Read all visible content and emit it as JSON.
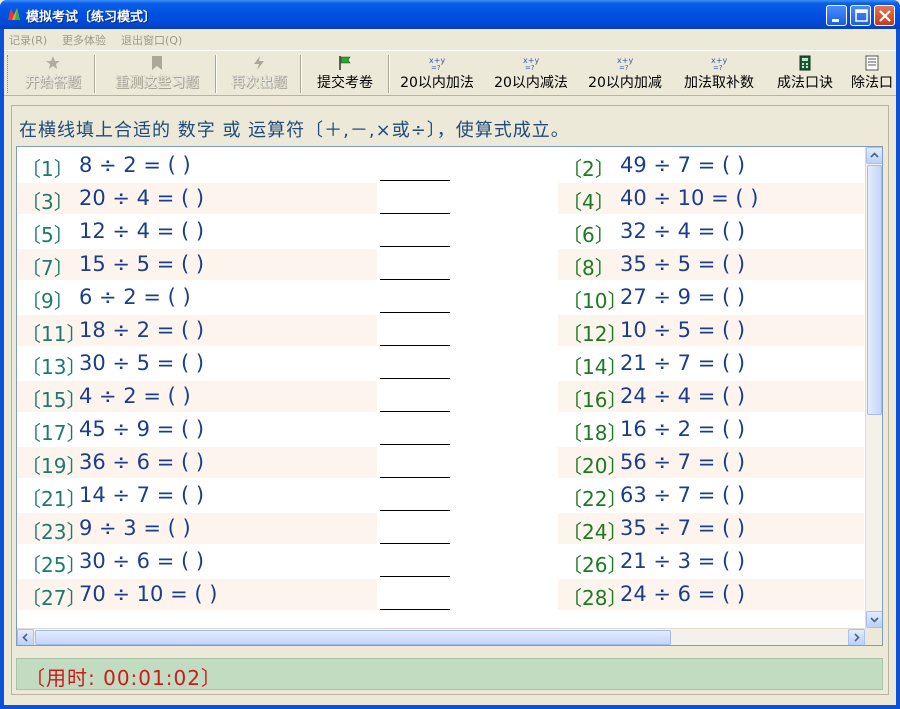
{
  "window": {
    "title": "模拟考试〔练习模式〕"
  },
  "menu": [
    "记录(R)",
    "更多体验",
    "退出窗口(Q)"
  ],
  "toolbar": [
    {
      "label": "开始答题",
      "icon": "star-pin-icon",
      "enabled": false
    },
    {
      "label": "重测这些习题",
      "icon": "bookmark-icon",
      "enabled": false
    },
    {
      "label": "再次出题",
      "icon": "lightning-icon",
      "enabled": false
    },
    {
      "label": "提交考卷",
      "icon": "flag-icon",
      "enabled": true
    },
    {
      "label": "20以内加法",
      "icon": "xy-formula-icon",
      "enabled": true
    },
    {
      "label": "20以内减法",
      "icon": "xy-formula-icon",
      "enabled": true
    },
    {
      "label": "20以内加减",
      "icon": "xy-formula-icon",
      "enabled": true
    },
    {
      "label": "加法取补数",
      "icon": "xy-formula-icon",
      "enabled": true
    },
    {
      "label": "成法口诀",
      "icon": "calculator-icon",
      "enabled": true
    },
    {
      "label": "除法口",
      "icon": "document-icon",
      "enabled": true
    }
  ],
  "instruction": "在横线填上合适的 数字 或 运算符〔＋,－,×或÷〕，使算式成立。",
  "questions": [
    {
      "num": "〔1〕",
      "expr": "8 ÷ 2 = (     )"
    },
    {
      "num": "〔2〕",
      "expr": "49 ÷ 7 = (     )"
    },
    {
      "num": "〔3〕",
      "expr": "20 ÷ 4 = (     )"
    },
    {
      "num": "〔4〕",
      "expr": "40 ÷ 10 = (     )"
    },
    {
      "num": "〔5〕",
      "expr": "12 ÷ 4 = (     )"
    },
    {
      "num": "〔6〕",
      "expr": "32 ÷ 4 = (     )"
    },
    {
      "num": "〔7〕",
      "expr": "15 ÷ 5 = (     )"
    },
    {
      "num": "〔8〕",
      "expr": "35 ÷ 5 = (     )"
    },
    {
      "num": "〔9〕",
      "expr": "6 ÷ 2 = (     )"
    },
    {
      "num": "〔10〕",
      "expr": "27 ÷ 9 = (     )"
    },
    {
      "num": "〔11〕",
      "expr": "18 ÷ 2 = (     )"
    },
    {
      "num": "〔12〕",
      "expr": "10 ÷ 5 = (     )"
    },
    {
      "num": "〔13〕",
      "expr": "30 ÷ 5 = (     )"
    },
    {
      "num": "〔14〕",
      "expr": "21 ÷ 7 = (     )"
    },
    {
      "num": "〔15〕",
      "expr": "4 ÷ 2 = (     )"
    },
    {
      "num": "〔16〕",
      "expr": "24 ÷ 4 = (     )"
    },
    {
      "num": "〔17〕",
      "expr": "45 ÷ 9 = (     )"
    },
    {
      "num": "〔18〕",
      "expr": "16 ÷ 2 = (     )"
    },
    {
      "num": "〔19〕",
      "expr": "36 ÷ 6 = (     )"
    },
    {
      "num": "〔20〕",
      "expr": "56 ÷ 7 = (     )"
    },
    {
      "num": "〔21〕",
      "expr": "14 ÷ 7 = (     )"
    },
    {
      "num": "〔22〕",
      "expr": "63 ÷ 7 = (     )"
    },
    {
      "num": "〔23〕",
      "expr": "9 ÷ 3 = (     )"
    },
    {
      "num": "〔24〕",
      "expr": "35 ÷ 7 = (     )"
    },
    {
      "num": "〔25〕",
      "expr": "30 ÷ 6 = (     )"
    },
    {
      "num": "〔26〕",
      "expr": "21 ÷ 3 = (     )"
    },
    {
      "num": "〔27〕",
      "expr": "70 ÷ 10 = (     )"
    },
    {
      "num": "〔28〕",
      "expr": "24 ÷ 6 = (     )"
    }
  ],
  "timer": "〔用时: 00:01:02〕",
  "colors": {
    "question_number_left": "#1f7a6e",
    "question_number_right": "#1c7a22",
    "expression": "#1a3e8c",
    "timer": "#d01818",
    "statusbar": "#c2dcc2",
    "row_alt": "#fdf4ee"
  }
}
